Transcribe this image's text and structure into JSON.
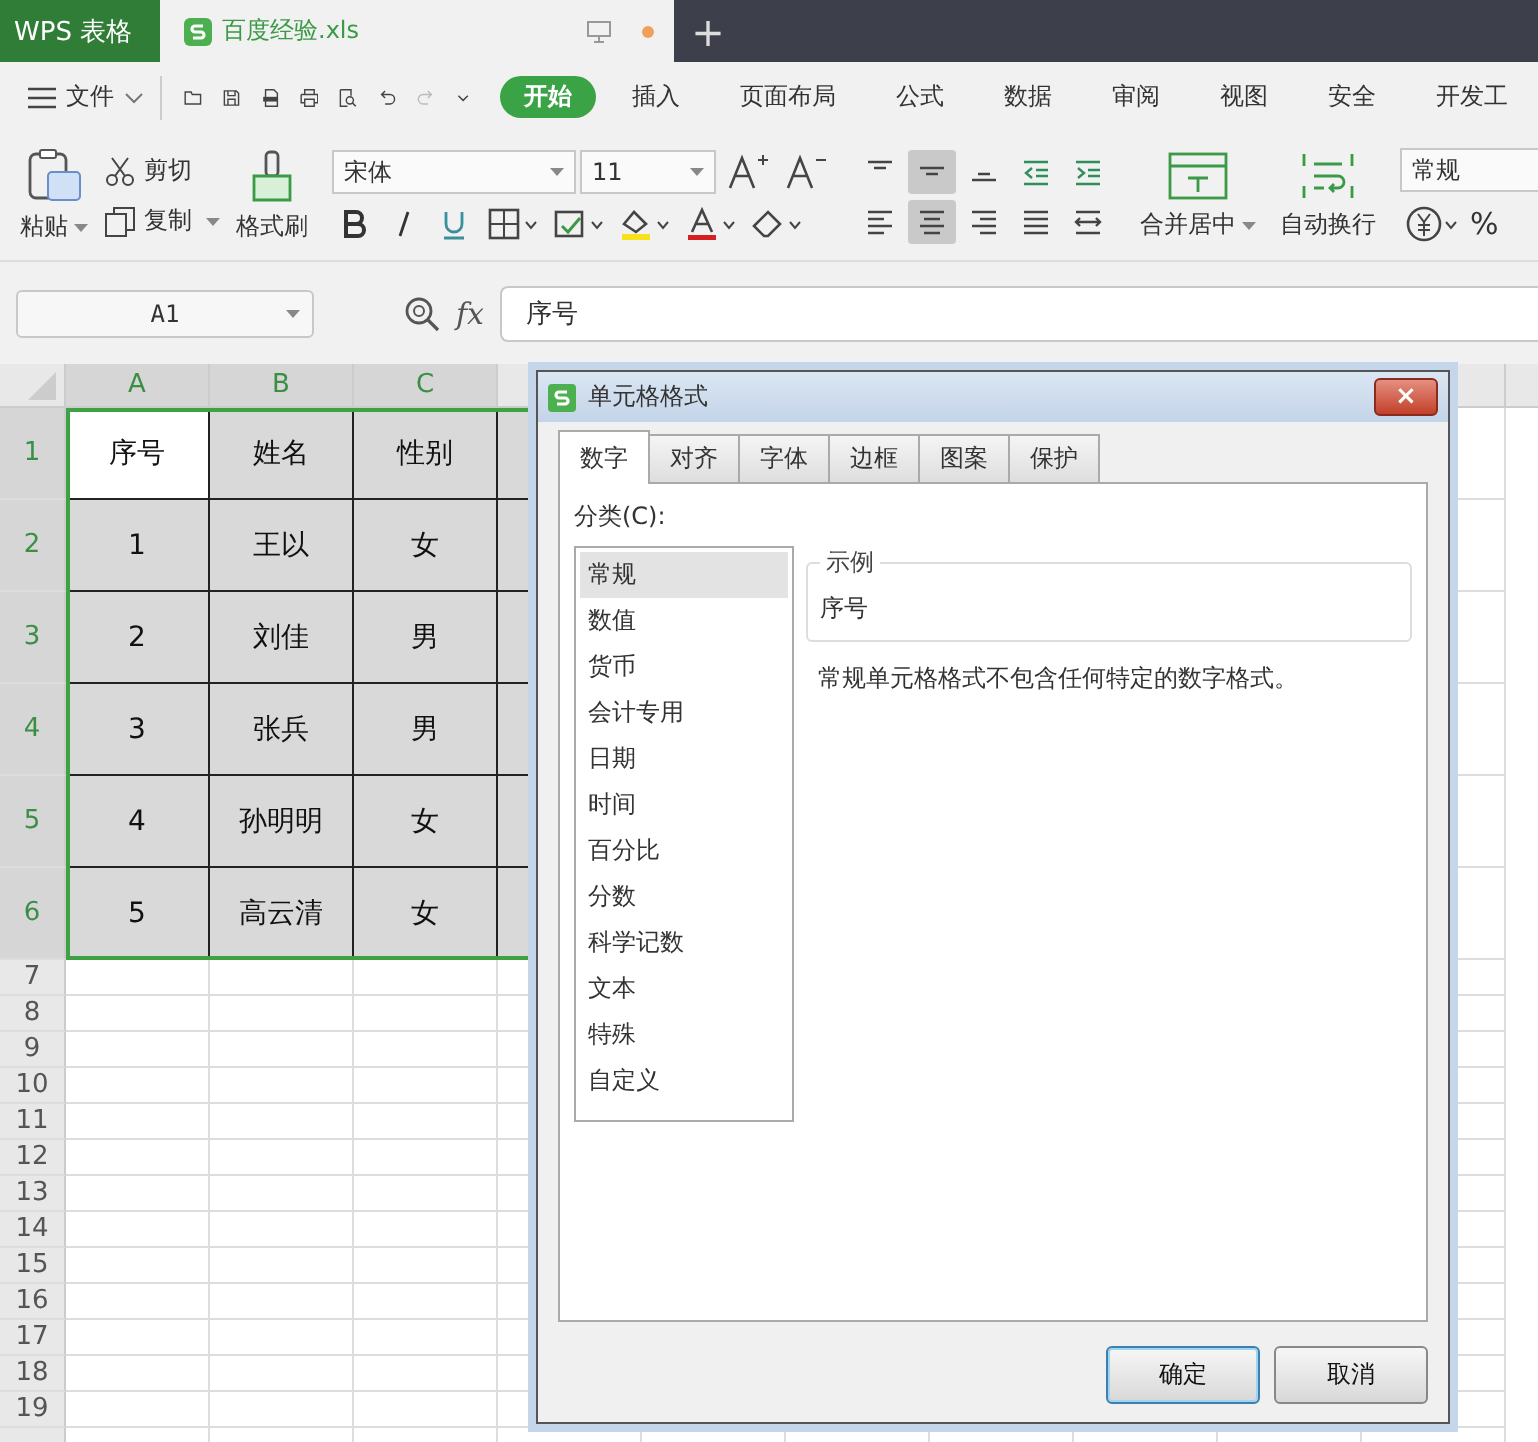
{
  "titlebar": {
    "app_tab": "WPS 表格",
    "file_tab": {
      "name": "百度经验.xls",
      "modified": true
    },
    "new_tab": "+"
  },
  "menu": {
    "file": "文件",
    "tabs": [
      {
        "label": "开始",
        "selected": true
      },
      {
        "label": "插入",
        "selected": false
      },
      {
        "label": "页面布局",
        "selected": false
      },
      {
        "label": "公式",
        "selected": false
      },
      {
        "label": "数据",
        "selected": false
      },
      {
        "label": "审阅",
        "selected": false
      },
      {
        "label": "视图",
        "selected": false
      },
      {
        "label": "安全",
        "selected": false
      },
      {
        "label": "开发工",
        "selected": false
      }
    ]
  },
  "ribbon": {
    "paste": "粘贴",
    "cut": "剪切",
    "copy": "复制",
    "format_painter": "格式刷",
    "font": "宋体",
    "font_size": "11",
    "merge": "合并居中",
    "wrap": "自动换行",
    "number_format": "常规",
    "currency": "%",
    "align_buttons": [
      {
        "kind": "top",
        "selected": false
      },
      {
        "kind": "middle",
        "selected": true
      },
      {
        "kind": "bottom",
        "selected": false
      },
      {
        "kind": "outdent",
        "selected": false
      },
      {
        "kind": "indent",
        "selected": false
      },
      {
        "kind": "left",
        "selected": false
      },
      {
        "kind": "center",
        "selected": true
      },
      {
        "kind": "right",
        "selected": false
      },
      {
        "kind": "justify",
        "selected": false
      },
      {
        "kind": "distribute",
        "selected": false
      }
    ]
  },
  "formula_bar": {
    "name_box": "A1",
    "fx": "fx",
    "value": "序号"
  },
  "sheet": {
    "columns": [
      "A",
      "B",
      "C"
    ],
    "rows": [
      {
        "header": "1",
        "cells": [
          {
            "text": "序号",
            "active": true
          },
          {
            "text": "姓名",
            "active": false
          },
          {
            "text": "性别",
            "active": false
          }
        ]
      },
      {
        "header": "2",
        "cells": [
          {
            "text": "1",
            "active": false
          },
          {
            "text": "王以",
            "active": false
          },
          {
            "text": "女",
            "active": false
          }
        ]
      },
      {
        "header": "3",
        "cells": [
          {
            "text": "2",
            "active": false
          },
          {
            "text": "刘佳",
            "active": false
          },
          {
            "text": "男",
            "active": false
          }
        ]
      },
      {
        "header": "4",
        "cells": [
          {
            "text": "3",
            "active": false
          },
          {
            "text": "张兵",
            "active": false
          },
          {
            "text": "男",
            "active": false
          }
        ]
      },
      {
        "header": "5",
        "cells": [
          {
            "text": "4",
            "active": false
          },
          {
            "text": "孙明明",
            "active": false
          },
          {
            "text": "女",
            "active": false
          }
        ]
      },
      {
        "header": "6",
        "cells": [
          {
            "text": "5",
            "active": false
          },
          {
            "text": "高云清",
            "active": false
          },
          {
            "text": "女",
            "active": false
          }
        ]
      }
    ],
    "empty_rows": [
      "7",
      "8",
      "9",
      "10",
      "11",
      "12",
      "13",
      "14",
      "15",
      "16",
      "17",
      "18",
      "19"
    ]
  },
  "dialog": {
    "title": "单元格格式",
    "close": "×",
    "tabs": [
      {
        "label": "数字",
        "selected": true
      },
      {
        "label": "对齐",
        "selected": false
      },
      {
        "label": "字体",
        "selected": false
      },
      {
        "label": "边框",
        "selected": false
      },
      {
        "label": "图案",
        "selected": false
      },
      {
        "label": "保护",
        "selected": false
      }
    ],
    "category_label": "分类(C):",
    "categories": [
      {
        "label": "常规",
        "selected": true
      },
      {
        "label": "数值",
        "selected": false
      },
      {
        "label": "货币",
        "selected": false
      },
      {
        "label": "会计专用",
        "selected": false
      },
      {
        "label": "日期",
        "selected": false
      },
      {
        "label": "时间",
        "selected": false
      },
      {
        "label": "百分比",
        "selected": false
      },
      {
        "label": "分数",
        "selected": false
      },
      {
        "label": "科学记数",
        "selected": false
      },
      {
        "label": "文本",
        "selected": false
      },
      {
        "label": "特殊",
        "selected": false
      },
      {
        "label": "自定义",
        "selected": false
      }
    ],
    "sample_legend": "示例",
    "sample_value": "序号",
    "description": "常规单元格格式不包含任何特定的数字格式。",
    "buttons": [
      {
        "label": "确定",
        "kind": "default"
      },
      {
        "label": "取消",
        "kind": "normal"
      }
    ]
  }
}
